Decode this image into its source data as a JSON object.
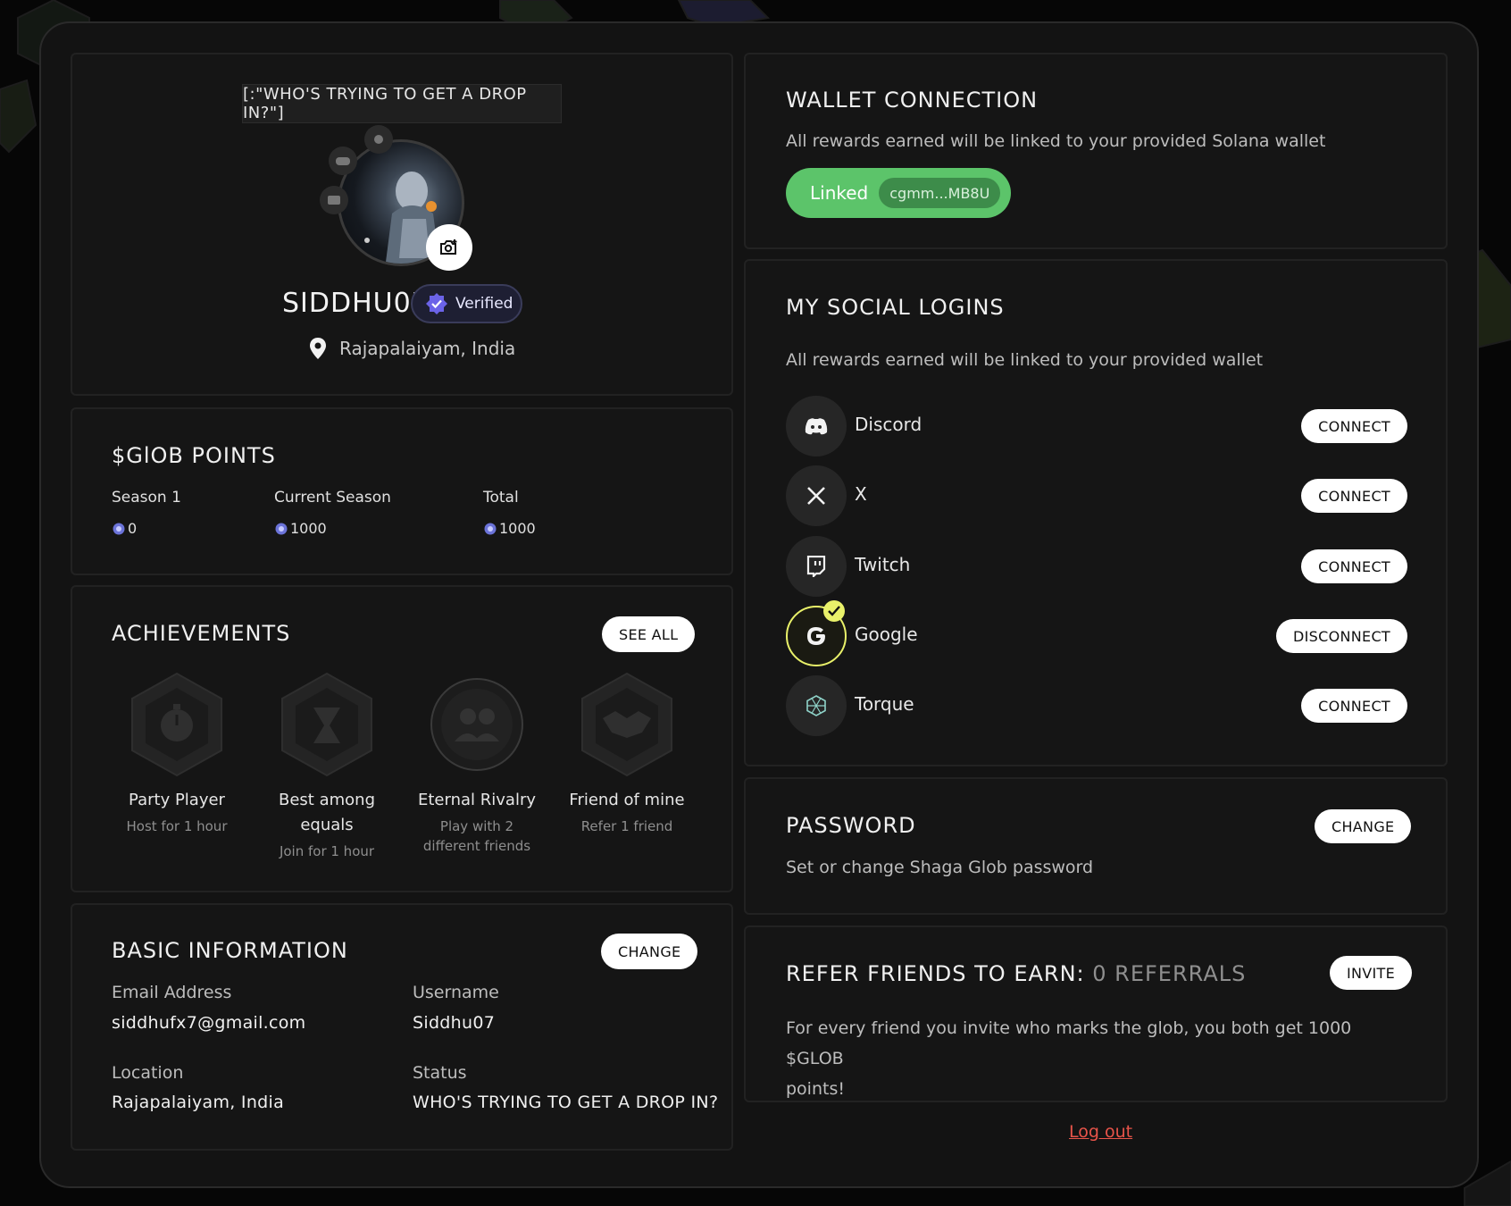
{
  "profile": {
    "status_quote": "[:\"WHO'S TRYING TO GET A DROP IN?\"]",
    "username": "SIDDHU07",
    "verified_label": "Verified",
    "location": "Rajapalaiyam, India"
  },
  "points": {
    "title": "$GlOB POINTS",
    "columns": [
      {
        "label": "Season 1",
        "value": "0"
      },
      {
        "label": "Current Season",
        "value": "1000"
      },
      {
        "label": "Total",
        "value": "1000"
      }
    ]
  },
  "achievements": {
    "title": "ACHIEVEMENTS",
    "see_all": "SEE ALL",
    "items": [
      {
        "title": "Party Player",
        "sub": "Host for 1 hour",
        "icon": "stopwatch-icon"
      },
      {
        "title": "Best among equals",
        "sub": "Join for 1 hour",
        "icon": "hourglass-icon"
      },
      {
        "title": "Eternal Rivalry",
        "sub": "Play with 2 different friends",
        "icon": "users-icon"
      },
      {
        "title": "Friend of mine",
        "sub": "Refer 1 friend",
        "icon": "handshake-icon"
      }
    ]
  },
  "basic_info": {
    "title": "BASIC INFORMATION",
    "change": "CHANGE",
    "email_label": "Email Address",
    "email": "siddhufx7@gmail.com",
    "username_label": "Username",
    "username": "Siddhu07",
    "location_label": "Location",
    "location": "Rajapalaiyam, India",
    "status_label": "Status",
    "status": "WHO'S TRYING TO GET A DROP IN?"
  },
  "wallet": {
    "title": "WALLET CONNECTION",
    "desc": "All rewards earned will be linked to your provided Solana wallet",
    "linked_label": "Linked",
    "address": "cgmm...MB8U"
  },
  "social": {
    "title": "MY SOCIAL LOGINS",
    "desc": "All rewards earned will be linked to your provided wallet",
    "items": [
      {
        "name": "Discord",
        "action": "CONNECT",
        "icon": "discord-icon"
      },
      {
        "name": "X",
        "action": "CONNECT",
        "icon": "x-icon"
      },
      {
        "name": "Twitch",
        "action": "CONNECT",
        "icon": "twitch-icon"
      },
      {
        "name": "Google",
        "action": "DISCONNECT",
        "icon": "google-icon",
        "connected": true
      },
      {
        "name": "Torque",
        "action": "CONNECT",
        "icon": "torque-icon"
      }
    ]
  },
  "password": {
    "title": "PASSWORD",
    "change": "CHANGE",
    "desc": "Set or change Shaga Glob password"
  },
  "refer": {
    "title": "REFER FRIENDS TO EARN:",
    "count": "0 REFERRALS",
    "invite": "INVITE",
    "desc_line1": "For every friend you invite who marks the glob, you both get 1000 $GLOB",
    "desc_line2": "points!"
  },
  "logout": "Log out",
  "colors": {
    "accent_green": "#5cc46a",
    "google_ring": "#e9f16a",
    "logout_red": "#e8544a",
    "verified_purple": "#6b63e8"
  }
}
